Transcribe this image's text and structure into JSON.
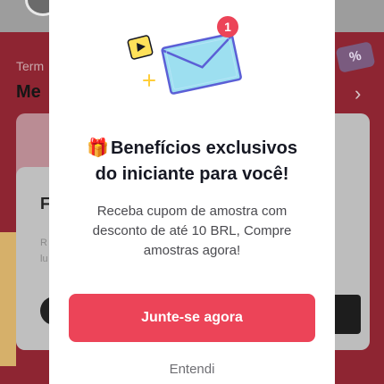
{
  "background": {
    "section_label": "Term",
    "section_title": "Me",
    "card_title": "F",
    "card_line1": "R",
    "card_line2": "lu",
    "tag_symbol": "%",
    "chevron": "›"
  },
  "modal": {
    "gift_emoji": "🎁",
    "headline_line1": "Benefícios exclusivos",
    "headline_line2": "do iniciante para você!",
    "description": "Receba cupom de amostra com desconto de até 10 BRL, Compre amostras agora!",
    "primary_button": "Junte-se agora",
    "dismiss_button": "Entendi",
    "notification_count": "1"
  },
  "colors": {
    "accent": "#ec4458",
    "envelope": "#9ddff0",
    "envelope_outline": "#5b5fd6",
    "badge": "#ec4458",
    "sticker_yellow": "#ffe15a"
  }
}
